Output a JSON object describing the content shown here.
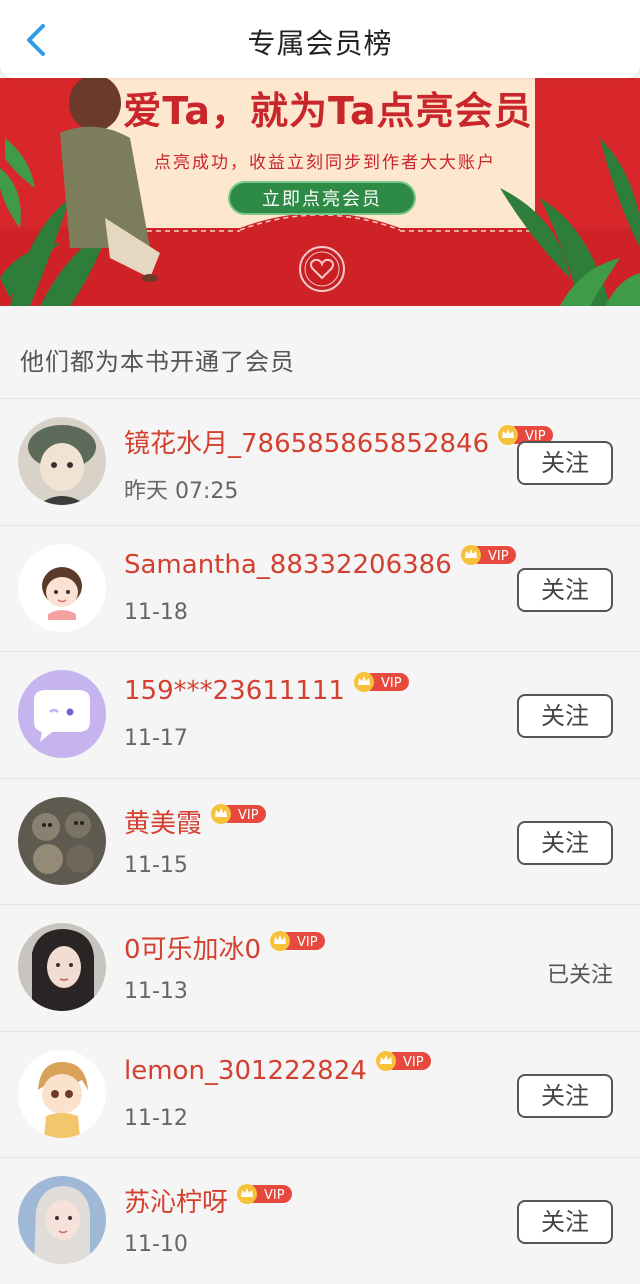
{
  "header": {
    "title": "专属会员榜"
  },
  "banner": {
    "title": "爱Ta，就为Ta点亮会员",
    "subtitle": "点亮成功，收益立刻同步到作者大大账户",
    "button_label": "立即点亮会员"
  },
  "section": {
    "title": "他们都为本书开通了会员"
  },
  "vip_label": "VIP",
  "members": [
    {
      "name": "镜花水月_786585865852846",
      "date": "昨天 07:25",
      "follow_label": "关注",
      "followed": false
    },
    {
      "name": "Samantha_88332206386",
      "date": "11-18",
      "follow_label": "关注",
      "followed": false
    },
    {
      "name": "159***23611111",
      "date": "11-17",
      "follow_label": "关注",
      "followed": false
    },
    {
      "name": "黄美霞",
      "date": "11-15",
      "follow_label": "关注",
      "followed": false
    },
    {
      "name": "0可乐加冰0",
      "date": "11-13",
      "follow_label": "已关注",
      "followed": true
    },
    {
      "name": "lemon_301222824",
      "date": "11-12",
      "follow_label": "关注",
      "followed": false
    },
    {
      "name": "苏沁柠呀",
      "date": "11-10",
      "follow_label": "关注",
      "followed": false
    }
  ],
  "colors": {
    "accent_red": "#d4402f",
    "banner_red": "#d8272b",
    "back_blue": "#2f9be6"
  }
}
